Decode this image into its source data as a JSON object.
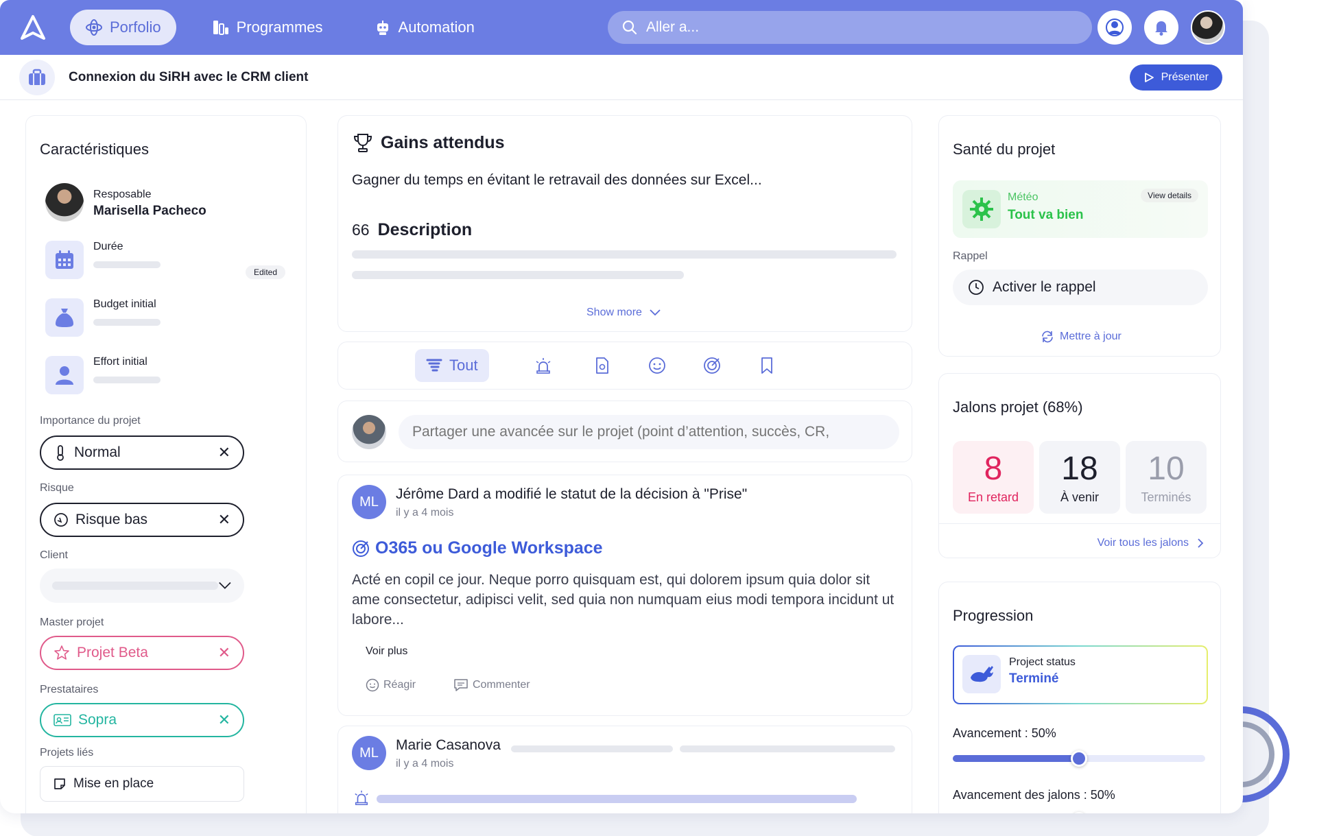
{
  "nav": {
    "items": [
      {
        "label": "Porfolio",
        "icon": "atom-icon"
      },
      {
        "label": "Programmes",
        "icon": "programmes-icon"
      },
      {
        "label": "Automation",
        "icon": "robot-icon"
      }
    ],
    "search_placeholder": "Aller a..."
  },
  "project": {
    "title": "Connexion du SiRH avec le CRM client",
    "present_label": "Présenter"
  },
  "characteristics": {
    "title": "Caractéristiques",
    "responsable_label": "Resposable",
    "responsable_name": "Marisella Pacheco",
    "duree_label": "Durée",
    "budget_label": "Budget initial",
    "budget_badge": "Edited",
    "effort_label": "Effort initial",
    "importance_label": "Importance du projet",
    "importance_value": "Normal",
    "risque_label": "Risque",
    "risque_value": "Risque bas",
    "client_label": "Client",
    "master_label": "Master projet",
    "master_value": "Projet Beta",
    "prestataires_label": "Prestataires",
    "prestataires_value": "Sopra",
    "projets_lies_label": "Projets liés",
    "projets_lies_value": "Mise en place"
  },
  "gains": {
    "title": "Gains attendus",
    "text": "Gagner du temps en évitant le retravail des données sur Excel...",
    "desc_title": "Description",
    "desc_mark": "66",
    "show_more": "Show more"
  },
  "filters": {
    "active_label": "Tout"
  },
  "composer": {
    "placeholder": "Partager une avancée sur le projet (point d’attention, succès, CR,"
  },
  "feed": [
    {
      "initials": "ML",
      "headline": "Jérôme Dard a modifié le statut de la décision à \"Prise\"",
      "time": "il y a 4 mois",
      "decision_title": "O365 ou Google Workspace",
      "body": "Acté en copil ce jour. Neque porro quisquam est, qui dolorem ipsum quia dolor sit ame consectetur, adipisci velit, sed quia non numquam eius modi tempora incidunt ut labore...",
      "voir_plus": "Voir plus",
      "react": "Réagir",
      "comment": "Commenter"
    },
    {
      "initials": "ML",
      "headline": "Marie Casanova",
      "time": "il y a 4 mois"
    }
  ],
  "health": {
    "title": "Santé du projet",
    "meteo_label": "Météo",
    "meteo_value": "Tout va bien",
    "view_details": "View details",
    "rappel_label": "Rappel",
    "rappel_button": "Activer le rappel",
    "update_label": "Mettre à jour"
  },
  "jalons": {
    "title": "Jalons projet (68%)",
    "stats": [
      {
        "value": "8",
        "label": "En retard"
      },
      {
        "value": "18",
        "label": "À venir"
      },
      {
        "value": "10",
        "label": "Terminés"
      }
    ],
    "see_all": "Voir tous les jalons"
  },
  "progression": {
    "title": "Progression",
    "status_label": "Project status",
    "status_value": "Terminé",
    "avancement_label": "Avancement : 50%",
    "avancement_value": 50,
    "jalons_label": "Avancement des jalons : 50%",
    "jalons_value": 50
  },
  "colors": {
    "primary": "#6b7de3",
    "accent_blue": "#3d5bd9",
    "late_red": "#e0245e",
    "success_green": "#2bc24a",
    "pink": "#e05a8a",
    "teal": "#23b5a0"
  }
}
